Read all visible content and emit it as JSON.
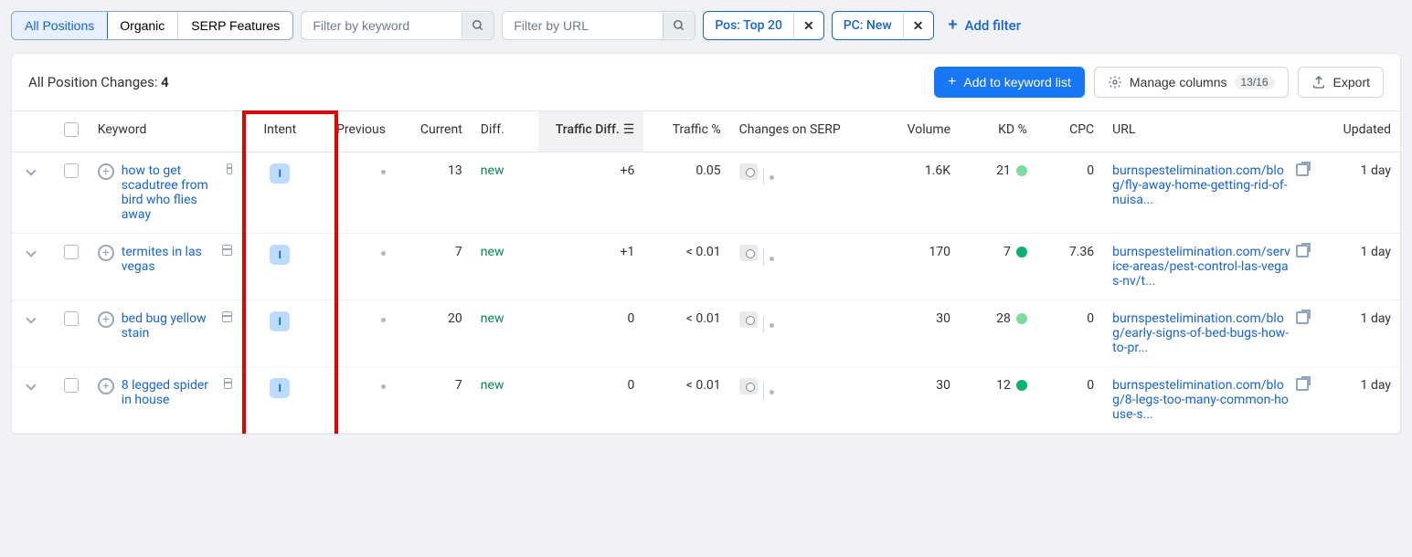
{
  "segmented": {
    "all_positions": "All Positions",
    "organic": "Organic",
    "serp_features": "SERP Features"
  },
  "filters": {
    "keyword_placeholder": "Filter by keyword",
    "url_placeholder": "Filter by URL",
    "chip_pos": "Pos: Top 20",
    "chip_pc": "PC: New",
    "add_filter": "Add filter"
  },
  "header": {
    "title_prefix": "All Position Changes: ",
    "count": "4",
    "add_kw": "Add to keyword list",
    "manage_cols": "Manage columns",
    "cols_count": "13/16",
    "export": "Export"
  },
  "columns": {
    "keyword": "Keyword",
    "intent": "Intent",
    "previous": "Previous",
    "current": "Current",
    "diff": "Diff.",
    "traffic_diff": "Traffic Diff.",
    "traffic_pct": "Traffic %",
    "changes": "Changes on SERP",
    "volume": "Volume",
    "kd": "KD %",
    "cpc": "CPC",
    "url": "URL",
    "updated": "Updated"
  },
  "rows": [
    {
      "keyword": "how to get scadutree from bird who flies away",
      "intent": "I",
      "previous": "",
      "current": "13",
      "diff": "new",
      "traffic_diff": "+6",
      "traffic_pct": "0.05",
      "volume": "1.6K",
      "kd": "21",
      "kd_color": "#7ddc9d",
      "cpc": "0",
      "url": "burnspestelimination.com/blog/fly-away-home-getting-rid-of-nuisa...",
      "updated": "1 day"
    },
    {
      "keyword": "termites in las vegas",
      "intent": "I",
      "previous": "",
      "current": "7",
      "diff": "new",
      "traffic_diff": "+1",
      "traffic_pct": "< 0.01",
      "volume": "170",
      "kd": "7",
      "kd_color": "#0bb36d",
      "cpc": "7.36",
      "url": "burnspestelimination.com/service-areas/pest-control-las-vegas-nv/t...",
      "updated": "1 day"
    },
    {
      "keyword": "bed bug yellow stain",
      "intent": "I",
      "previous": "",
      "current": "20",
      "diff": "new",
      "traffic_diff": "0",
      "traffic_pct": "< 0.01",
      "volume": "30",
      "kd": "28",
      "kd_color": "#7ddc9d",
      "cpc": "0",
      "url": "burnspestelimination.com/blog/early-signs-of-bed-bugs-how-to-pr...",
      "updated": "1 day"
    },
    {
      "keyword": "8 legged spider in house",
      "intent": "I",
      "previous": "",
      "current": "7",
      "diff": "new",
      "traffic_diff": "0",
      "traffic_pct": "< 0.01",
      "volume": "30",
      "kd": "12",
      "kd_color": "#0bb36d",
      "cpc": "0",
      "url": "burnspestelimination.com/blog/8-legs-too-many-common-house-s...",
      "updated": "1 day"
    }
  ]
}
